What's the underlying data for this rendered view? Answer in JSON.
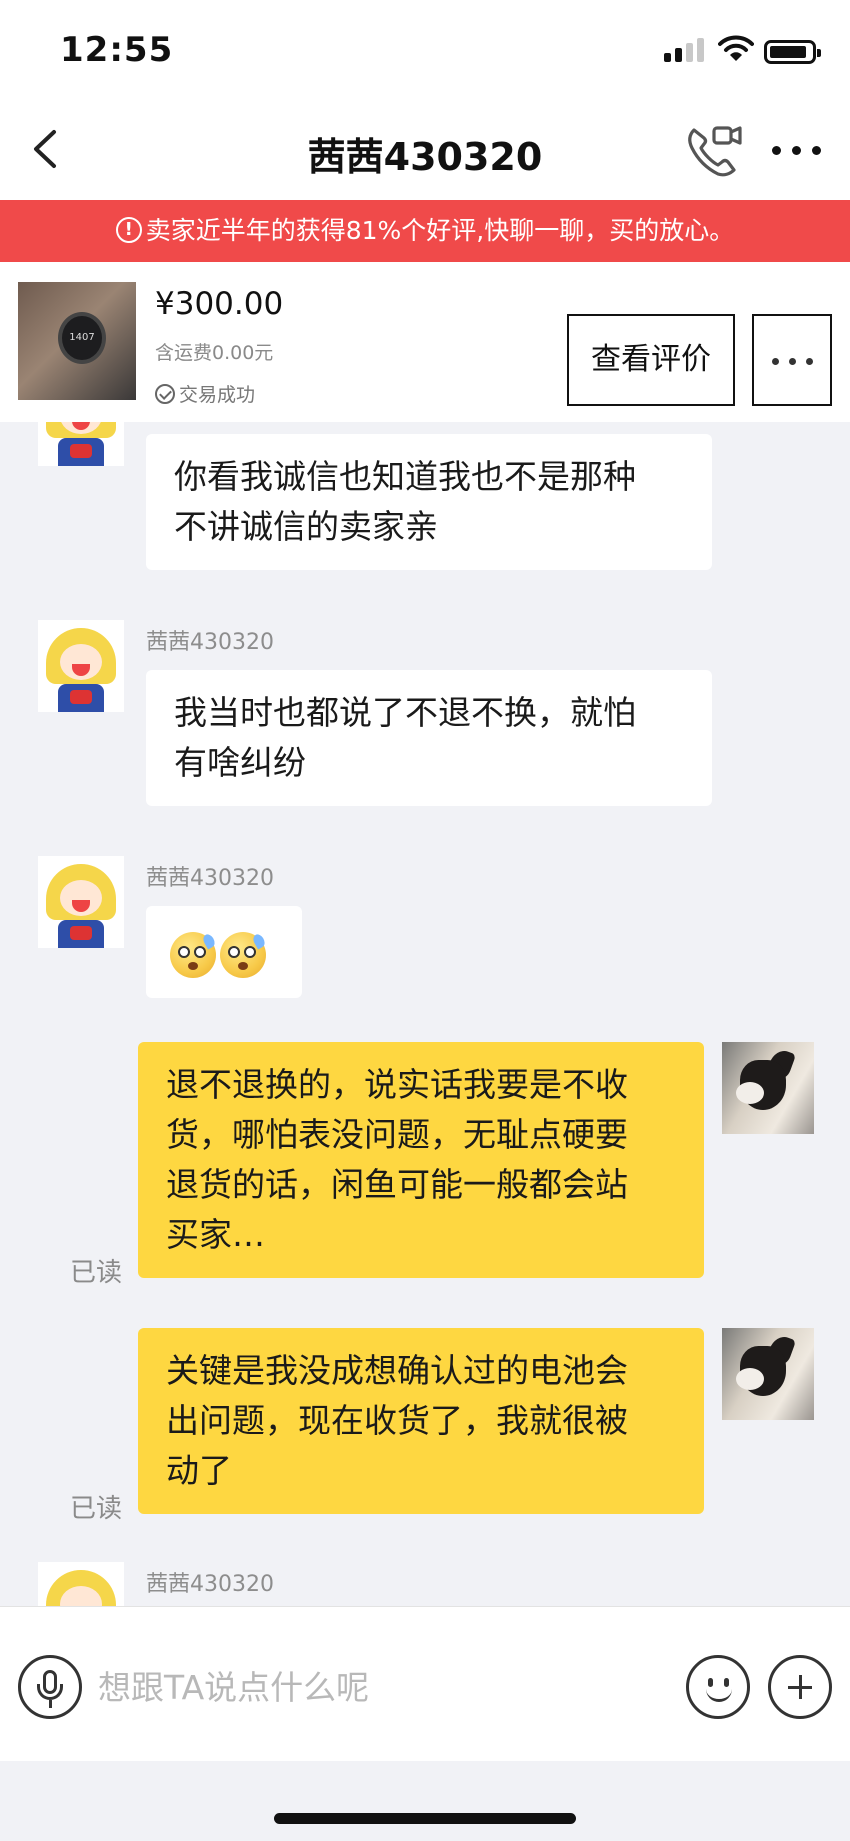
{
  "status_bar": {
    "time": "12:55"
  },
  "nav": {
    "title": "茜茜430320"
  },
  "notice": {
    "icon": "!",
    "text": "卖家近半年的获得81%个好评,快聊一聊，买的放心。"
  },
  "product": {
    "image_text": "1407",
    "price": "¥300.00",
    "shipping": "含运费0.00元",
    "status": "交易成功",
    "review_button": "查看评价"
  },
  "messages": [
    {
      "from": "seller",
      "sender_name": "",
      "text_lines": [
        "你看我诚信也知道我也不是那种",
        "不讲诚信的卖家亲"
      ]
    },
    {
      "from": "seller",
      "sender_name": "茜茜430320",
      "text_lines": [
        "我当时也都说了不退不换，就怕",
        "有啥纠纷"
      ]
    },
    {
      "from": "seller",
      "sender_name": "茜茜430320",
      "emojis": [
        "flushed-sweat-emoji",
        "flushed-sweat-emoji"
      ]
    },
    {
      "from": "me",
      "read": "已读",
      "text_lines": [
        "退不退换的，说实话我要是不收",
        "货，哪怕表没问题，无耻点硬要",
        "退货的话，闲鱼可能一般都会站",
        "买家…"
      ]
    },
    {
      "from": "me",
      "read": "已读",
      "text_lines": [
        "关键是我没成想确认过的电池会",
        "出问题，现在收货了，我就很被",
        "动了"
      ]
    },
    {
      "from": "seller",
      "sender_name": "茜茜430320",
      "text_lines": []
    }
  ],
  "input": {
    "placeholder": "想跟TA说点什么呢"
  },
  "colors": {
    "notice_red": "#f04a4a",
    "my_bubble": "#fed741",
    "chat_bg": "#f1f2f6"
  },
  "icons": [
    "back-arrow-icon",
    "video-call-icon",
    "more-icon",
    "microphone-icon",
    "smiley-icon",
    "plus-icon"
  ]
}
